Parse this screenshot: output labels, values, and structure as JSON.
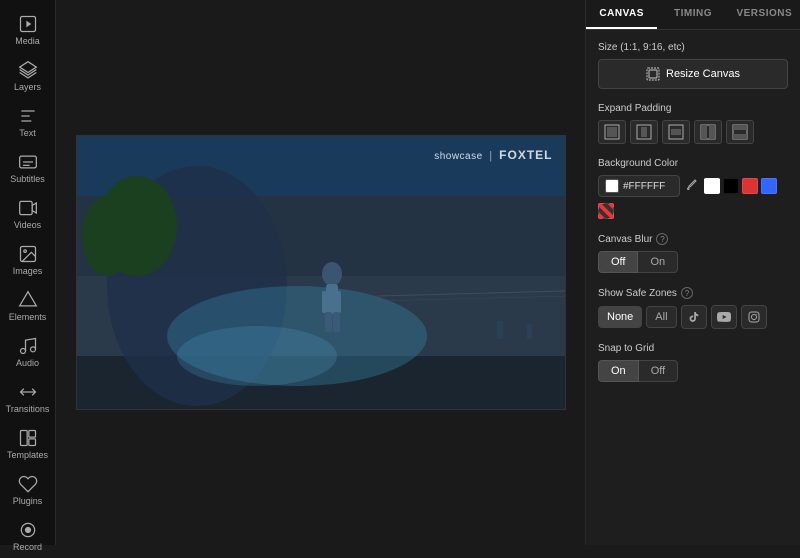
{
  "sidebar": {
    "items": [
      {
        "id": "media",
        "label": "Media",
        "icon": "🎬"
      },
      {
        "id": "layers",
        "label": "Layers",
        "icon": "⬛"
      },
      {
        "id": "text",
        "label": "Text",
        "icon": "✏️"
      },
      {
        "id": "subtitles",
        "label": "Subtitles",
        "icon": "💬"
      },
      {
        "id": "videos",
        "label": "Videos",
        "icon": "📹"
      },
      {
        "id": "images",
        "label": "Images",
        "icon": "🖼️"
      },
      {
        "id": "elements",
        "label": "Elements",
        "icon": "⬡"
      },
      {
        "id": "audio",
        "label": "Audio",
        "icon": "🎵"
      },
      {
        "id": "transitions",
        "label": "Transitions",
        "icon": "⇄"
      },
      {
        "id": "templates",
        "label": "Templates",
        "icon": "📄"
      },
      {
        "id": "plugins",
        "label": "Plugins",
        "icon": "🔌"
      },
      {
        "id": "record",
        "label": "Record",
        "icon": "⏺"
      }
    ]
  },
  "canvas": {
    "watermark_brand": "showcase",
    "watermark_channel": "FOXTEL"
  },
  "right_panel": {
    "tabs": [
      {
        "id": "canvas",
        "label": "CANVAS",
        "active": true
      },
      {
        "id": "timing",
        "label": "TIMING",
        "active": false
      },
      {
        "id": "versions",
        "label": "VERSIONS",
        "active": false
      }
    ],
    "size_section": {
      "label": "Size (1:1, 9:16, etc)",
      "button_label": "Resize Canvas"
    },
    "expand_padding_section": {
      "label": "Expand Padding"
    },
    "background_color_section": {
      "label": "Background Color",
      "hex_value": "#FFFFFF",
      "hex_placeholder": "#FFFFFF",
      "swatches": [
        {
          "color": "#FFFFFF",
          "label": "white"
        },
        {
          "color": "#000000",
          "label": "black"
        },
        {
          "color": "#dd3333",
          "label": "red"
        },
        {
          "color": "#3366ff",
          "label": "blue"
        }
      ]
    },
    "canvas_blur_section": {
      "label": "Canvas Blur",
      "help": "?",
      "options": [
        {
          "id": "off",
          "label": "Off",
          "active": true
        },
        {
          "id": "on",
          "label": "On",
          "active": false
        }
      ]
    },
    "show_safe_zones_section": {
      "label": "Show Safe Zones",
      "help": "?",
      "options": [
        {
          "id": "none",
          "label": "None",
          "active": true
        },
        {
          "id": "all",
          "label": "All",
          "active": false
        }
      ],
      "platforms": [
        {
          "id": "tiktok",
          "icon": "TT"
        },
        {
          "id": "youtube",
          "icon": "YT"
        },
        {
          "id": "instagram",
          "icon": "IG"
        }
      ]
    },
    "snap_to_grid_section": {
      "label": "Snap to Grid",
      "options": [
        {
          "id": "on",
          "label": "On",
          "active": true
        },
        {
          "id": "off",
          "label": "Off",
          "active": false
        }
      ]
    }
  }
}
